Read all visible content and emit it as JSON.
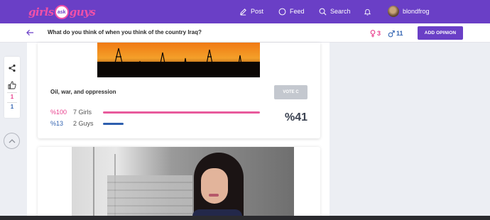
{
  "logo": {
    "part1": "girls",
    "part2": "ask",
    "part3": "guys"
  },
  "nav": {
    "post": "Post",
    "feed": "Feed",
    "search": "Search",
    "username": "blondfrog"
  },
  "question": {
    "title": "What do you think of when you think of the country Iraq?",
    "girls_count": "3",
    "guys_count": "11",
    "add_opinion": "ADD OPINION"
  },
  "rail": {
    "upvotes": "1",
    "downvotes": "1"
  },
  "poll": {
    "option_label": "Oil, war, and oppression",
    "vote_button": "VOTE C",
    "girls": {
      "percent_label": "%100",
      "count_label": "7 Girls",
      "fraction": 1.0
    },
    "guys": {
      "percent_label": "%13",
      "count_label": "2 Guys",
      "fraction": 0.13
    },
    "total_percent": "%41"
  },
  "colors": {
    "brand": "#6a3fc6",
    "girls": "#e83e8c",
    "guys": "#3465b2"
  }
}
